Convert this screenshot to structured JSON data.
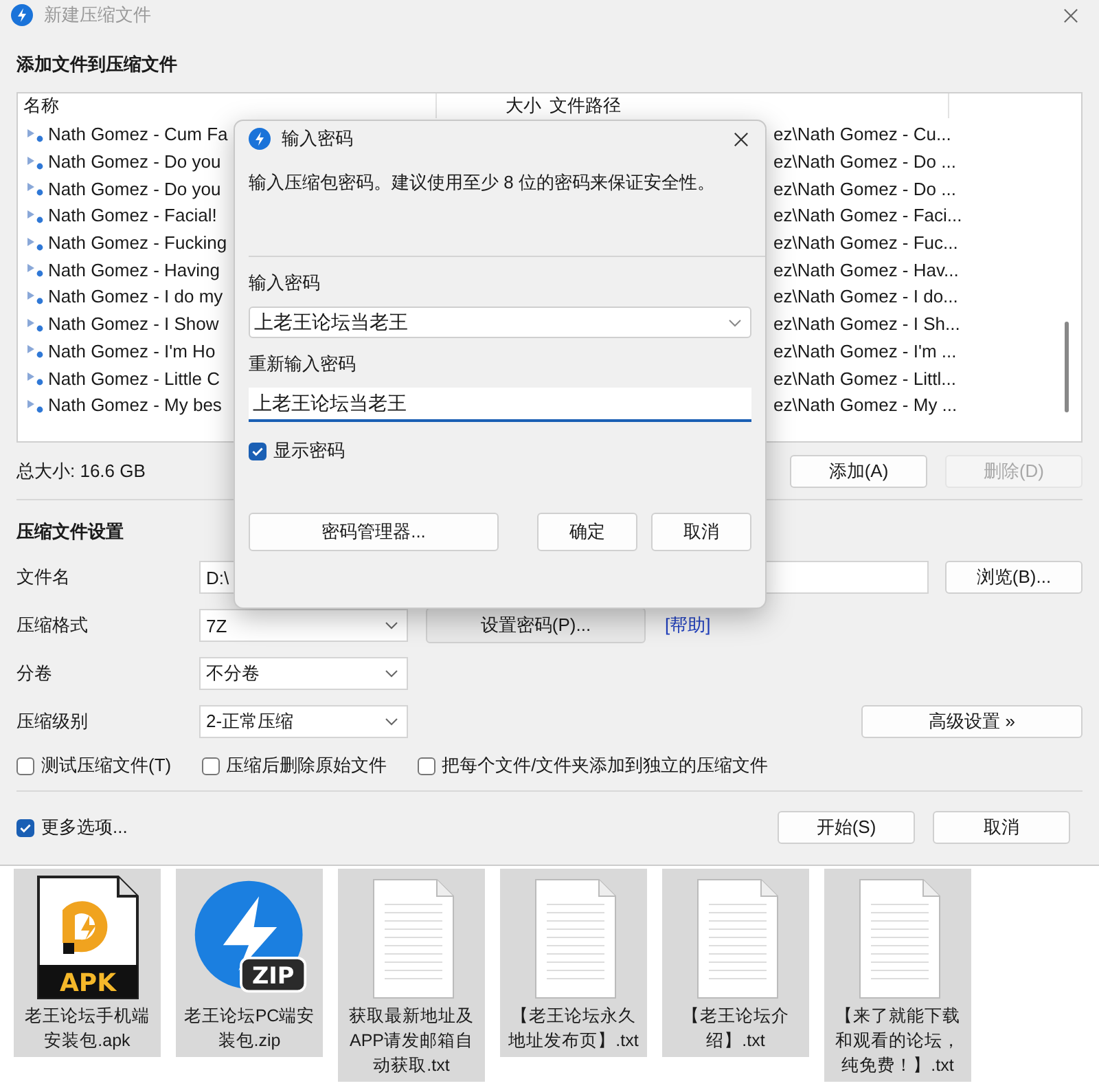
{
  "window": {
    "title": "新建压缩文件"
  },
  "files_section": {
    "heading": "添加文件到压缩文件",
    "columns": [
      "名称",
      "大小",
      "文件路径"
    ],
    "rows": [
      {
        "name": "Nath Gomez - Cum Fa",
        "path": "ez\\Nath Gomez - Cu..."
      },
      {
        "name": "Nath Gomez - Do you",
        "path": "ez\\Nath Gomez - Do ..."
      },
      {
        "name": "Nath Gomez - Do you",
        "path": "ez\\Nath Gomez - Do ..."
      },
      {
        "name": "Nath Gomez - Facial!",
        "path": "ez\\Nath Gomez - Faci..."
      },
      {
        "name": "Nath Gomez - Fucking",
        "path": "ez\\Nath Gomez - Fuc..."
      },
      {
        "name": "Nath Gomez - Having",
        "path": "ez\\Nath Gomez - Hav..."
      },
      {
        "name": "Nath Gomez - I do my",
        "path": "ez\\Nath Gomez - I do..."
      },
      {
        "name": "Nath Gomez - I Show",
        "path": "ez\\Nath Gomez - I Sh..."
      },
      {
        "name": "Nath Gomez - I'm Ho",
        "path": "ez\\Nath Gomez - I'm ..."
      },
      {
        "name": "Nath Gomez - Little C",
        "path": "ez\\Nath Gomez - Littl..."
      },
      {
        "name": "Nath Gomez - My bes",
        "path": "ez\\Nath Gomez - My ..."
      }
    ],
    "total": "总大小: 16.6 GB",
    "buttons": [
      {
        "label": "添加(A)",
        "disabled": false
      },
      {
        "label": "删除(D)",
        "disabled": true
      }
    ]
  },
  "settings": {
    "heading": "压缩文件设置",
    "filename": {
      "label": "文件名",
      "value": "D:\\"
    },
    "browse": "浏览(B)...",
    "format": {
      "label": "压缩格式",
      "value": "7Z"
    },
    "set_password": "设置密码(P)...",
    "help": "[帮助]",
    "split": {
      "label": "分卷",
      "value": "不分卷"
    },
    "level": {
      "label": "压缩级别",
      "value": "2-正常压缩"
    },
    "advanced": "高级设置 »",
    "options": [
      {
        "label": "测试压缩文件(T)",
        "checked": false
      },
      {
        "label": "压缩后删除原始文件",
        "checked": false
      },
      {
        "label": "把每个文件/文件夹添加到独立的压缩文件",
        "checked": false
      }
    ]
  },
  "footer": {
    "more_options": {
      "label": "更多选项...",
      "checked": true
    },
    "buttons": [
      "开始(S)",
      "取消"
    ]
  },
  "dialog": {
    "title": "输入密码",
    "message": "输入压缩包密码。建议使用至少 8 位的密码来保证安全性。",
    "password_label": "输入密码",
    "password": "上老王论坛当老王",
    "repeat_label": "重新输入密码",
    "repeat": "上老王论坛当老王",
    "show_password": {
      "label": "显示密码",
      "checked": true
    },
    "buttons": [
      "密码管理器...",
      "确定",
      "取消"
    ]
  },
  "desktop_files": [
    {
      "name": "老王论坛手机端安装包.apk",
      "kind": "apk",
      "badge": "APK",
      "selected": true
    },
    {
      "name": "老王论坛PC端安装包.zip",
      "kind": "zip",
      "badge": "ZIP",
      "selected": true
    },
    {
      "name": "获取最新地址及APP请发邮箱自动获取.txt",
      "kind": "txt",
      "selected": true
    },
    {
      "name": "【老王论坛永久地址发布页】.txt",
      "kind": "txt",
      "selected": true
    },
    {
      "name": "【老王论坛介绍】.txt",
      "kind": "txt",
      "selected": true
    },
    {
      "name": "【来了就能下载和观看的论坛，纯免费！】.txt",
      "kind": "txt",
      "selected": true
    }
  ]
}
